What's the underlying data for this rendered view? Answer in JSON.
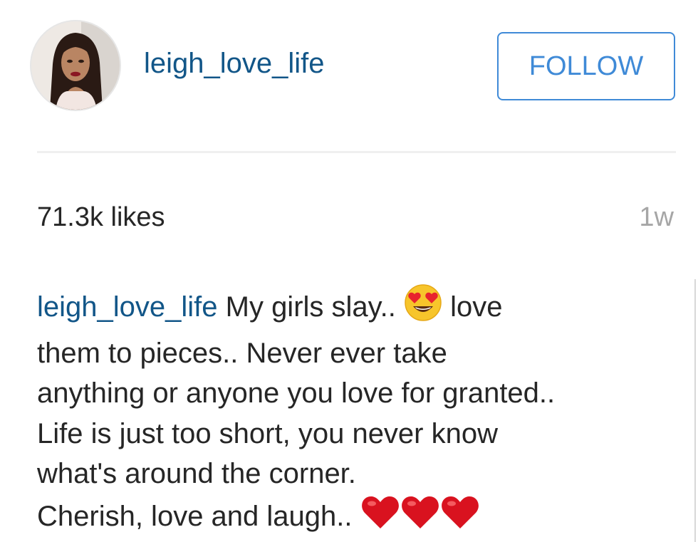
{
  "header": {
    "username": "leigh_love_life",
    "follow_label": "FOLLOW"
  },
  "stats": {
    "likes": "71.3k likes",
    "time": "1w"
  },
  "caption": {
    "username": "leigh_love_life",
    "line1_a": " My girls slay.. ",
    "line1_b": " love",
    "line2": "them to pieces.. Never ever take",
    "line3": "anything or anyone you love for granted..",
    "line4": "Life is just too short, you never know",
    "line5": "what's around the corner.",
    "line6": "Cherish, love and laugh.. ",
    "emoji_after_slay": "heart-eyes-emoji",
    "emoji_end": [
      "red-heart-emoji",
      "red-heart-emoji",
      "red-heart-emoji"
    ]
  },
  "colors": {
    "username_blue": "#125688",
    "follow_blue": "#3f8ad7",
    "text": "#262626",
    "muted": "#a6a6a6"
  }
}
